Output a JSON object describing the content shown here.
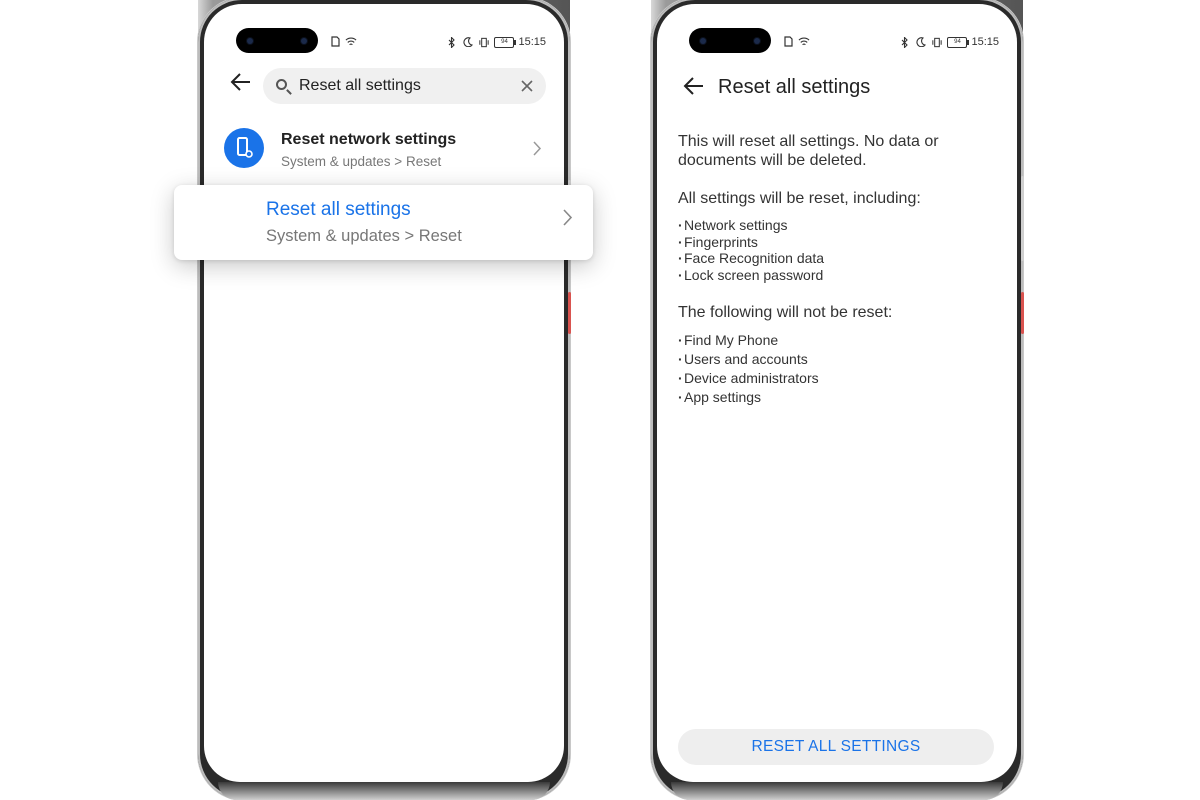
{
  "status_bar": {
    "time": "15:15",
    "left_icons": [
      "sim-icon",
      "wifi-icon"
    ],
    "right_icons": [
      "bluetooth-icon",
      "moon-icon",
      "vibrate-icon",
      "battery-icon"
    ],
    "battery_label": "94"
  },
  "search_screen": {
    "search": {
      "value": "Reset all settings",
      "icon": "search-icon",
      "clear_icon": "close-icon"
    },
    "results": [
      {
        "title": "Reset network settings",
        "subtitle": "System & updates > Reset",
        "icon": "phone-settings-icon"
      }
    ],
    "highlighted_result": {
      "title": "Reset all settings",
      "subtitle": "System & updates > Reset"
    }
  },
  "reset_screen": {
    "title": "Reset all settings",
    "intro": "This will reset all settings. No data or documents will be deleted.",
    "reset_heading": "All settings will be reset, including:",
    "reset_items": [
      "Network settings",
      "Fingerprints",
      "Face Recognition data",
      "Lock screen password"
    ],
    "keep_heading": "The following will not be reset:",
    "keep_items": [
      "Find My Phone",
      "Users and accounts",
      "Device administrators",
      "App settings"
    ],
    "button_label": "RESET ALL SETTINGS"
  },
  "colors": {
    "accent": "#1a73e8",
    "text_primary": "#222222",
    "text_secondary": "#777777",
    "button_bg": "#eeeeee"
  }
}
